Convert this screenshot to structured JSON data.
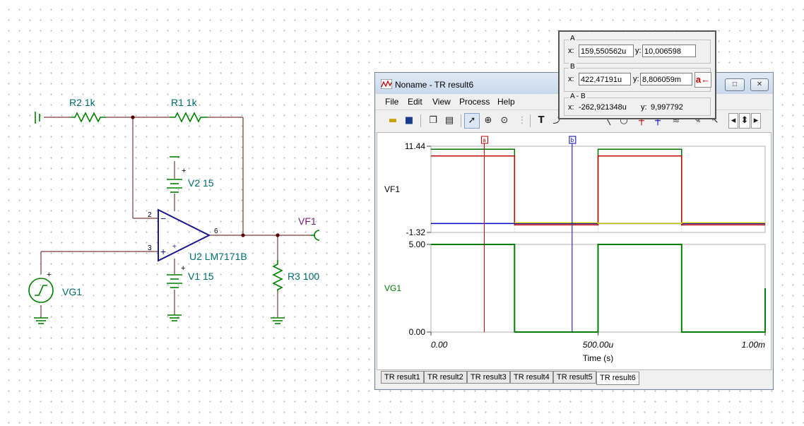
{
  "schematic": {
    "r2": "R2 1k",
    "r1": "R1 1k",
    "v2": "V2 15",
    "v1": "V1 15",
    "u2": "U2 LM7171B",
    "vf1": "VF1",
    "r3": "R3 100",
    "vg1": "VG1",
    "pin2": "2",
    "pin3": "3",
    "pin6": "6",
    "plus_sign": "+",
    "minus_sign": "−"
  },
  "window": {
    "title": "Noname - TR result6",
    "buttons": {
      "minimize": "─",
      "maximize": "□",
      "close": "✕"
    },
    "menu": [
      "File",
      "Edit",
      "View",
      "Process",
      "Help"
    ],
    "toolbar_icons": [
      "open-icon",
      "save-icon",
      "copy-icon",
      "paste-icon",
      "pointer-icon",
      "zoom-in-icon",
      "zoom-100-icon",
      "grid-icon",
      "text-tool-icon",
      "curve-label-icon",
      "line-tool-icon",
      "ellipse-tool-icon",
      "cursor-a-icon",
      "cursor-b-icon",
      "waves-icon",
      "pen-icon",
      "arrow-icon",
      "scroll-left-icon",
      "scroll-updown-icon",
      "scroll-right-icon"
    ],
    "tabs": [
      "TR result1",
      "TR result2",
      "TR result3",
      "TR result4",
      "TR result5",
      "TR result6"
    ],
    "active_tab": 5
  },
  "readout": {
    "a_title": "A",
    "a_x": "159,550562u",
    "a_y": "10,006598",
    "b_title": "B",
    "b_x": "422,47191u",
    "b_y": "8,806059m",
    "ab_title": "A - B",
    "ab_x": "-262,921348u",
    "ab_y": "9,997792",
    "x_label": "x:",
    "y_label": "y:",
    "a_button": "a←"
  },
  "chart_data": [
    {
      "type": "line",
      "ylabel": "VF1",
      "ylim": [
        -1.32,
        11.44
      ],
      "yticks": [
        "11.44",
        "-1.32"
      ],
      "xlim": [
        0,
        0.001
      ],
      "series": [
        {
          "name": "",
          "color": "#007000",
          "x": [
            0,
            0.00025,
            0.00025,
            0.0005,
            0.0005,
            0.00075,
            0.00075,
            0.001
          ],
          "y": [
            11.0,
            11.0,
            0.02,
            0.02,
            11.0,
            11.0,
            0.02,
            0.02
          ]
        },
        {
          "name": "",
          "color": "#c00000",
          "x": [
            0,
            0.00025,
            0.00025,
            0.0005,
            0.0005,
            0.00075,
            0.00075,
            0.001
          ],
          "y": [
            10.0,
            10.0,
            -0.2,
            -0.2,
            10.0,
            10.0,
            -0.2,
            -0.2
          ]
        },
        {
          "name": "",
          "color": "#0000c0",
          "x": [
            0,
            0.001
          ],
          "y": [
            0,
            0
          ]
        },
        {
          "name": "",
          "color": "#c8c800",
          "x": [
            0.00025,
            0.0005,
            0.0005,
            0.00075,
            0.00075,
            0.001
          ],
          "y": [
            0.1,
            0.1,
            0,
            0,
            0.1,
            0.1
          ]
        }
      ]
    },
    {
      "type": "line",
      "ylabel": "VG1",
      "ylim": [
        0,
        5
      ],
      "yticks": [
        "5.00",
        "0.00"
      ],
      "xlim": [
        0,
        0.001
      ],
      "xticks": [
        "0.00",
        "500.00u",
        "1.00m"
      ],
      "xlabel": "Time (s)",
      "series": [
        {
          "name": "",
          "color": "#008000",
          "x": [
            0,
            0.00025,
            0.00025,
            0.0005,
            0.0005,
            0.00075,
            0.00075,
            0.001,
            0.001
          ],
          "y": [
            5,
            5,
            0,
            0,
            5,
            5,
            0,
            0,
            2.5
          ]
        }
      ]
    }
  ],
  "cursors": {
    "a_x": 0.000159550562,
    "b_x": 0.00042247191,
    "a_label": "a",
    "b_label": "b"
  }
}
